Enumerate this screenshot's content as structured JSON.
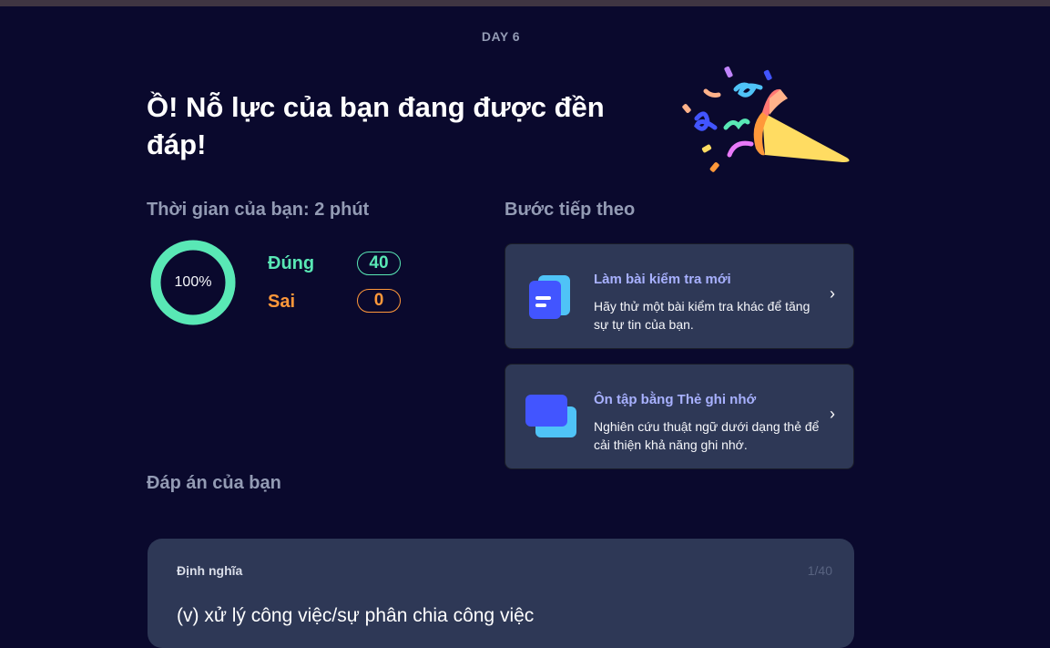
{
  "header": {
    "day_label": "DAY 6"
  },
  "hero": {
    "headline": "Ồ! Nỗ lực của bạn đang được đền đáp!",
    "illustration": "party-popper-confetti"
  },
  "results": {
    "time_label": "Thời gian của bạn: 2 phút",
    "percent_label": "100%",
    "percent_value": 100,
    "correct_label": "Đúng",
    "correct_count": "40",
    "wrong_label": "Sai",
    "wrong_count": "0"
  },
  "next_steps": {
    "title": "Bước tiếp theo",
    "cards": [
      {
        "title": "Làm bài kiểm tra mới",
        "description": "Hãy thử một bài kiểm tra khác để tăng sự tự tin của bạn.",
        "icon": "test-document-icon"
      },
      {
        "title": "Ôn tập bằng Thẻ ghi nhớ",
        "description": "Nghiên cứu thuật ngữ dưới dạng thẻ để cải thiện khả năng ghi nhớ.",
        "icon": "flashcards-icon"
      }
    ]
  },
  "answers": {
    "title": "Đáp án của bạn",
    "card_label": "Định nghĩa",
    "counter": "1/40",
    "term": "(v) xử lý công việc/sự phân chia công việc"
  },
  "colors": {
    "background": "#0a092d",
    "card": "#2e3856",
    "correct": "#59e8b5",
    "wrong": "#ff983a",
    "accent": "#a8b1ff",
    "muted": "#939bb4"
  }
}
